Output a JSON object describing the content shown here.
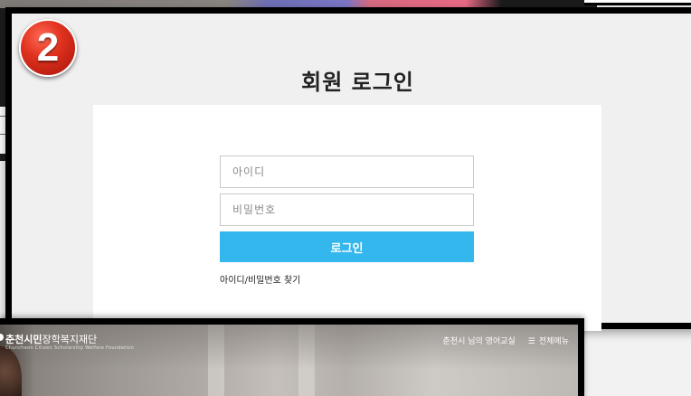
{
  "step_badge": "2",
  "page_title": "회원 로그인",
  "login_form": {
    "id_placeholder": "아이디",
    "password_placeholder": "비밀번호",
    "login_button": "로그인",
    "find_link": "아이디/비밀번호 찾기"
  },
  "bottom_site": {
    "logo_bold": "춘천시민",
    "logo_light": "장학복지재단",
    "logo_sub": "Chuncheon Citizen Scholarship Welfare Foundation",
    "nav_link": "춘천시 님의 영어교실",
    "menu_icon": "hamburger-icon",
    "menu_label": "전체메뉴"
  },
  "colors": {
    "login_button": "#34b7ec",
    "badge": "#e0321f",
    "panel_bg": "#f0f0f0"
  }
}
